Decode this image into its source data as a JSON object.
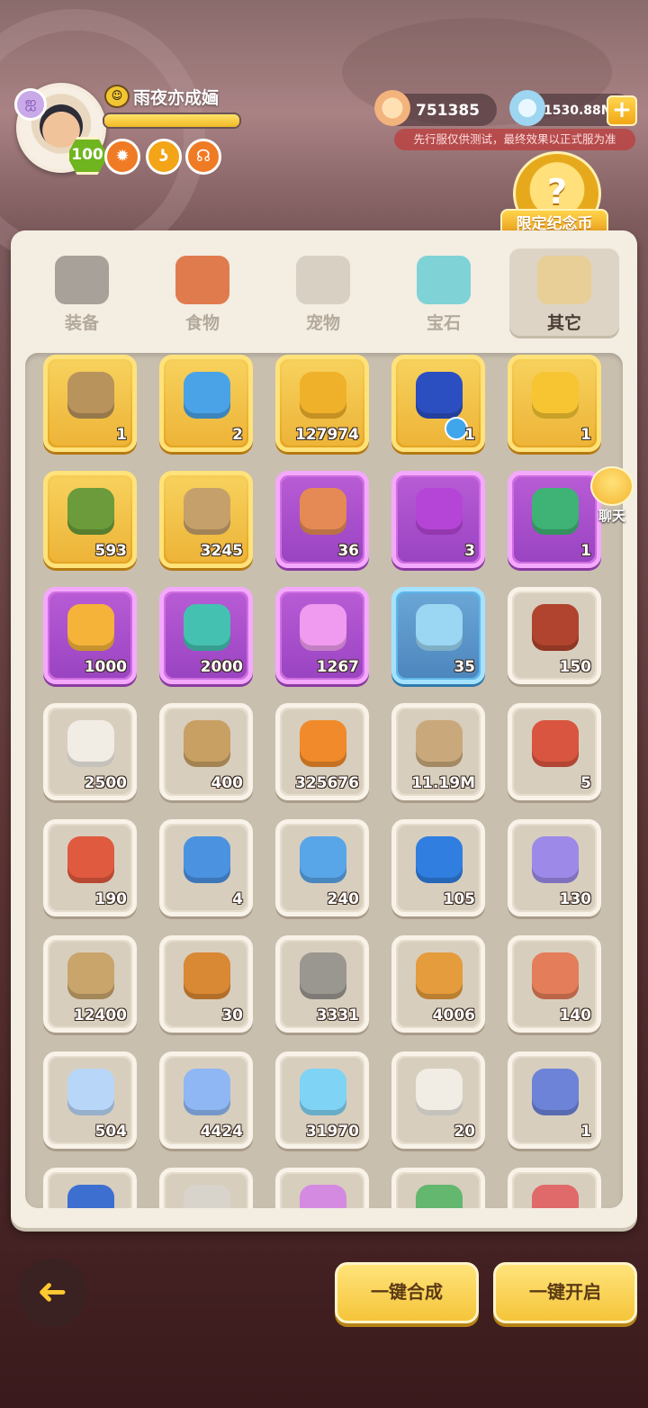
{
  "header": {
    "player_name": "雨夜亦成婳",
    "level": "100",
    "exp_progress": 1.0,
    "buff_icons": [
      "fire-buff-icon",
      "swirl-buff-icon",
      "shield-buff-icon"
    ],
    "coin_currency": "751385",
    "gem_currency": "1530.88M",
    "notice": "先行服仅供测试，最终效果以正式服为准",
    "limited_coin_label": "限定纪念币"
  },
  "tabs": [
    {
      "label": "装备",
      "icon": "axe-icon",
      "active": false
    },
    {
      "label": "食物",
      "icon": "food-bowl-icon",
      "active": false
    },
    {
      "label": "宠物",
      "icon": "fossil-skull-icon",
      "active": false
    },
    {
      "label": "宝石",
      "icon": "gem-icon",
      "active": false
    },
    {
      "label": "其它",
      "icon": "bone-icon",
      "active": true
    }
  ],
  "items": [
    {
      "qty": "1",
      "rarity": "gold",
      "icon": "stone-tablet-icon",
      "color": "#b9935c"
    },
    {
      "qty": "2",
      "rarity": "gold",
      "icon": "blue-sack-icon",
      "color": "#4aa3e6"
    },
    {
      "qty": "127974",
      "rarity": "gold",
      "icon": "gold-coin-icon",
      "color": "#f0b12a"
    },
    {
      "qty": "1",
      "rarity": "gold",
      "icon": "blue-skill-orb-icon",
      "color": "#2b4fc1"
    },
    {
      "qty": "1",
      "rarity": "gold",
      "icon": "gold-nugget-icon",
      "color": "#f6c531"
    },
    {
      "qty": "593",
      "rarity": "gold",
      "icon": "green-statue-icon",
      "color": "#6b9b3a"
    },
    {
      "qty": "3245",
      "rarity": "gold",
      "icon": "tan-statue-icon",
      "color": "#c6a06b"
    },
    {
      "qty": "36",
      "rarity": "purple",
      "icon": "portrait-card-icon",
      "color": "#e58a55"
    },
    {
      "qty": "3",
      "rarity": "purple",
      "icon": "purple-gem-icon",
      "color": "#b545d6"
    },
    {
      "qty": "1",
      "rarity": "purple",
      "icon": "green-sack-icon",
      "color": "#3fb275"
    },
    {
      "qty": "1000",
      "rarity": "purple",
      "icon": "star-stick-icon",
      "color": "#f5b33a"
    },
    {
      "qty": "2000",
      "rarity": "purple",
      "icon": "teal-ticket-icon",
      "color": "#45c1b2"
    },
    {
      "qty": "1267",
      "rarity": "purple",
      "icon": "pink-crystal-icon",
      "color": "#f09bf0"
    },
    {
      "qty": "35",
      "rarity": "blue",
      "icon": "crystal-pedestal-icon",
      "color": "#9bd6f2"
    },
    {
      "qty": "150",
      "rarity": "normal",
      "icon": "treasure-chest-icon",
      "color": "#b0442e"
    },
    {
      "qty": "2500",
      "rarity": "normal",
      "icon": "dice-icon",
      "color": "#f1ece4"
    },
    {
      "qty": "400",
      "rarity": "normal",
      "icon": "hammer-icon",
      "color": "#c9a064"
    },
    {
      "qty": "325676",
      "rarity": "normal",
      "icon": "orange-orb-icon",
      "color": "#f08a2a"
    },
    {
      "qty": "11.19M",
      "rarity": "normal",
      "icon": "medal-icon",
      "color": "#c9a97b"
    },
    {
      "qty": "5",
      "rarity": "normal",
      "icon": "dino-cone-icon",
      "color": "#d9553f"
    },
    {
      "qty": "190",
      "rarity": "normal",
      "icon": "dino-pot-icon",
      "color": "#e05a3f"
    },
    {
      "qty": "4",
      "rarity": "normal",
      "icon": "blue-dino-egg-icon",
      "color": "#4b92e1"
    },
    {
      "qty": "240",
      "rarity": "normal",
      "icon": "blue-dino-basket-icon",
      "color": "#58a5e8"
    },
    {
      "qty": "105",
      "rarity": "normal",
      "icon": "blue-crystal-icon",
      "color": "#2f7ee0"
    },
    {
      "qty": "130",
      "rarity": "normal",
      "icon": "violet-crystal-icon",
      "color": "#9d8ae8"
    },
    {
      "qty": "12400",
      "rarity": "normal",
      "icon": "map-scroll-icon",
      "color": "#c9a56c"
    },
    {
      "qty": "30",
      "rarity": "normal",
      "icon": "burger-icon",
      "color": "#d98834"
    },
    {
      "qty": "3331",
      "rarity": "normal",
      "icon": "stone-chisel-icon",
      "color": "#9a9690"
    },
    {
      "qty": "4006",
      "rarity": "normal",
      "icon": "meal-plate-icon",
      "color": "#e59c3c"
    },
    {
      "qty": "140",
      "rarity": "normal",
      "icon": "meat-icon",
      "color": "#e47d5a"
    },
    {
      "qty": "504",
      "rarity": "normal",
      "icon": "moon-icon",
      "color": "#b8d6f7"
    },
    {
      "qty": "4424",
      "rarity": "normal",
      "icon": "blue-star-icon",
      "color": "#8fb7f4"
    },
    {
      "qty": "31970",
      "rarity": "normal",
      "icon": "cyan-gem-icon",
      "color": "#7fd3f5"
    },
    {
      "qty": "20",
      "rarity": "normal",
      "icon": "dice-icon",
      "color": "#f1ece4"
    },
    {
      "qty": "1",
      "rarity": "normal",
      "icon": "figure-card-icon",
      "color": "#6c83d8"
    },
    {
      "qty": "",
      "rarity": "normal",
      "icon": "blue-crystal-icon",
      "color": "#3d6fd0"
    },
    {
      "qty": "",
      "rarity": "normal",
      "icon": "stone-icon",
      "color": "#d8d4cc"
    },
    {
      "qty": "",
      "rarity": "normal",
      "icon": "purple-rune-icon",
      "color": "#d48ae0"
    },
    {
      "qty": "",
      "rarity": "normal",
      "icon": "green-rune-icon",
      "color": "#63b76f"
    },
    {
      "qty": "",
      "rarity": "normal",
      "icon": "red-rune-icon",
      "color": "#e06a6a"
    }
  ],
  "chat_label": "聊天",
  "buttons": {
    "back": "back-arrow-icon",
    "synthesize": "一键合成",
    "open_all": "一键开启"
  }
}
